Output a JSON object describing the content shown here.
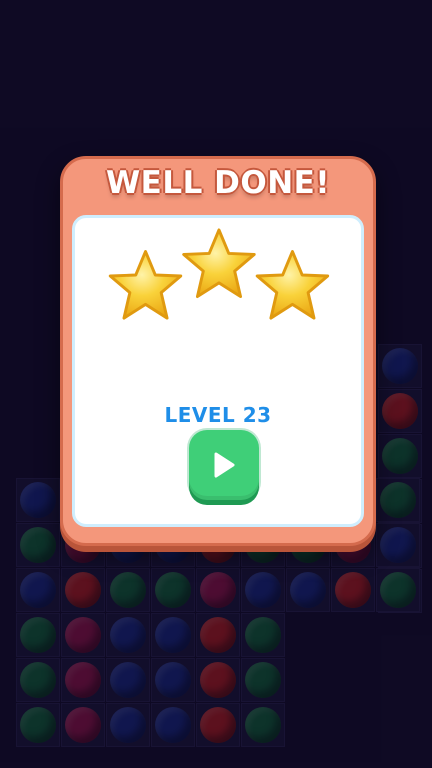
{
  "dialog": {
    "title": "WELL DONE!",
    "level_text": "LEVEL 23",
    "stars_earned": 3,
    "stars_total": 3,
    "play_icon": "play-icon"
  },
  "colors": {
    "background": "#150f2c",
    "dialog_frame": "#f4977b",
    "dialog_inner": "#ffffff",
    "level_text": "#1f8ee8",
    "play_button": "#3fcf78",
    "star": "#f7c928"
  },
  "board_ball_colors": [
    "#1a2c8a",
    "#a0164c",
    "#126a3a",
    "#c21f1f"
  ]
}
